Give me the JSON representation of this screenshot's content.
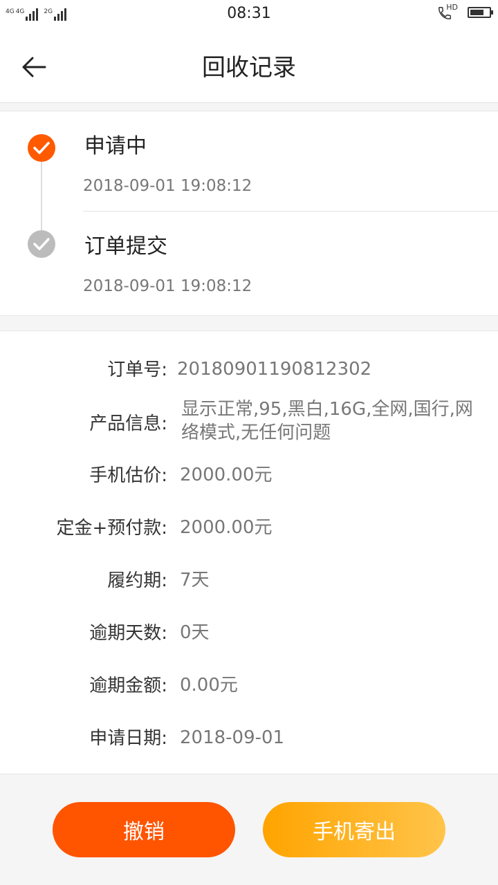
{
  "status_bar": {
    "sim1_label": "4G",
    "sim1_label2": "4G",
    "sim2_label": "2G",
    "time": "08:31",
    "hd_label": "HD"
  },
  "header": {
    "title": "回收记录"
  },
  "timeline": [
    {
      "title": "申请中",
      "time": "2018-09-01 19:08:12"
    },
    {
      "title": "订单提交",
      "time": "2018-09-01 19:08:12"
    }
  ],
  "details": [
    {
      "label": "订单号:",
      "value": "20180901190812302"
    },
    {
      "label": "产品信息:",
      "value": "显示正常,95,黑白,16G,全网,国行,网络模式,无任何问题"
    },
    {
      "label": "手机估价:",
      "value": "2000.00元"
    },
    {
      "label": "定金+预付款:",
      "value": "2000.00元"
    },
    {
      "label": "履约期:",
      "value": "7天"
    },
    {
      "label": "逾期天数:",
      "value": "0天"
    },
    {
      "label": "逾期金额:",
      "value": "0.00元"
    },
    {
      "label": "申请日期:",
      "value": "2018-09-01"
    }
  ],
  "actions": {
    "cancel_label": "撤销",
    "ship_label": "手机寄出"
  },
  "colors": {
    "accent_orange": "#ff5400",
    "ship_gradient_start": "#ffa400",
    "ship_gradient_end": "#ffc44a",
    "done_gray": "#bcbcbc"
  }
}
